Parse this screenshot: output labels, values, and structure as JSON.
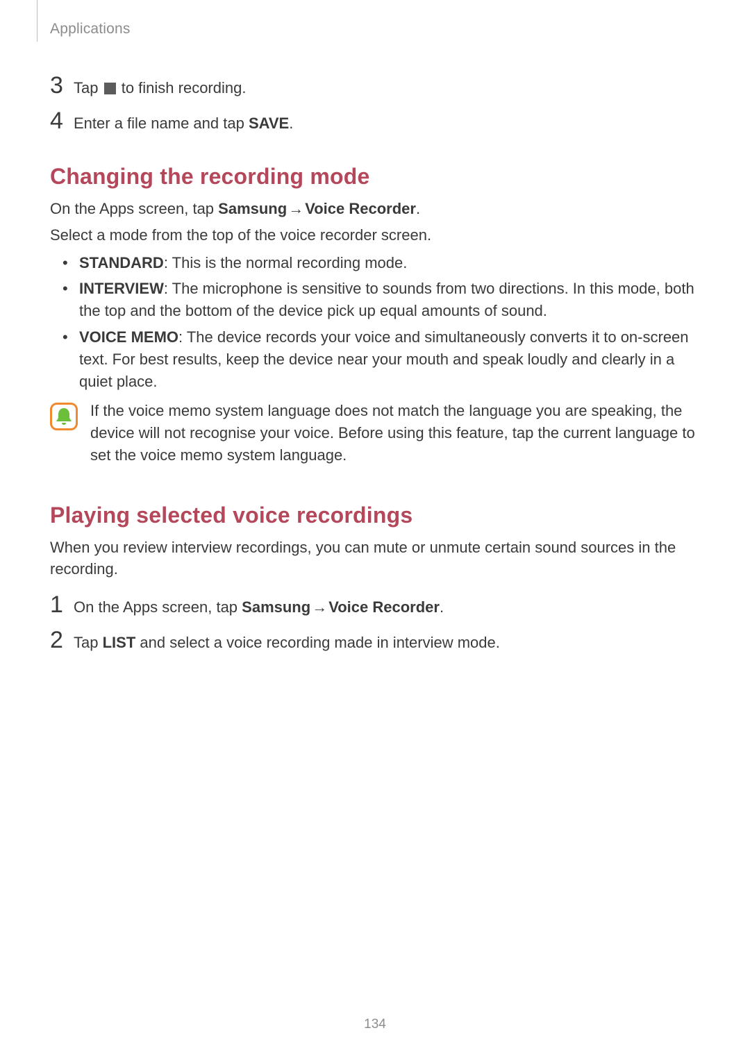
{
  "header": {
    "section": "Applications"
  },
  "steps_a": [
    {
      "num": "3",
      "parts": [
        {
          "t": "Tap "
        },
        {
          "icon": "stop"
        },
        {
          "t": " to finish recording."
        }
      ]
    },
    {
      "num": "4",
      "parts": [
        {
          "t": "Enter a file name and tap "
        },
        {
          "t": "SAVE",
          "bold": true
        },
        {
          "t": "."
        }
      ]
    }
  ],
  "heading1": "Changing the recording mode",
  "p1": {
    "parts": [
      {
        "t": "On the Apps screen, tap "
      },
      {
        "t": "Samsung",
        "bold": true
      },
      {
        "t": " → ",
        "arrow": true
      },
      {
        "t": "Voice Recorder",
        "bold": true
      },
      {
        "t": "."
      }
    ]
  },
  "p2": {
    "parts": [
      {
        "t": "Select a mode from the top of the voice recorder screen."
      }
    ]
  },
  "bullets": [
    {
      "parts": [
        {
          "t": "STANDARD",
          "bold": true
        },
        {
          "t": ": This is the normal recording mode."
        }
      ]
    },
    {
      "parts": [
        {
          "t": "INTERVIEW",
          "bold": true
        },
        {
          "t": ": The microphone is sensitive to sounds from two directions. In this mode, both the top and the bottom of the device pick up equal amounts of sound."
        }
      ]
    },
    {
      "parts": [
        {
          "t": "VOICE MEMO",
          "bold": true
        },
        {
          "t": ": The device records your voice and simultaneously converts it to on-screen text. For best results, keep the device near your mouth and speak loudly and clearly in a quiet place."
        }
      ]
    }
  ],
  "note": {
    "icon": "bell",
    "parts": [
      {
        "t": "If the voice memo system language does not match the language you are speaking, the device will not recognise your voice. Before using this feature, tap the current language to set the voice memo system language."
      }
    ]
  },
  "heading2": "Playing selected voice recordings",
  "p3": {
    "parts": [
      {
        "t": "When you review interview recordings, you can mute or unmute certain sound sources in the recording."
      }
    ]
  },
  "steps_b": [
    {
      "num": "1",
      "parts": [
        {
          "t": "On the Apps screen, tap "
        },
        {
          "t": "Samsung",
          "bold": true
        },
        {
          "t": " → ",
          "arrow": true
        },
        {
          "t": "Voice Recorder",
          "bold": true
        },
        {
          "t": "."
        }
      ]
    },
    {
      "num": "2",
      "parts": [
        {
          "t": "Tap "
        },
        {
          "t": "LIST",
          "bold": true
        },
        {
          "t": " and select a voice recording made in interview mode."
        }
      ]
    }
  ],
  "page_number": "134"
}
